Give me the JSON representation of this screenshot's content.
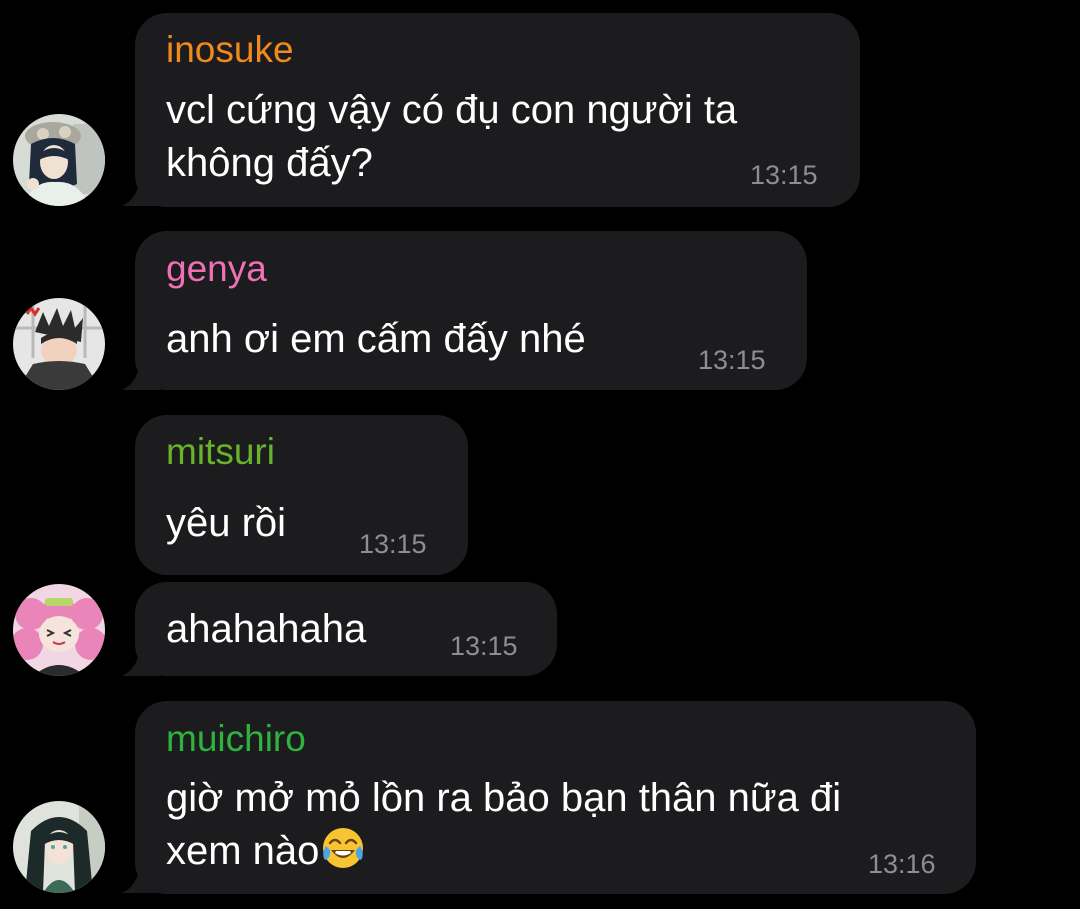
{
  "messages": [
    {
      "sender": "inosuke",
      "sender_color": "#ef8a1c",
      "lines": [
        "vcl cứng vậy có đụ con người ta",
        "không đấy?"
      ],
      "time": "13:15"
    },
    {
      "sender": "genya",
      "sender_color": "#ee70b5",
      "lines": [
        "anh ơi em cấm đấy nhé"
      ],
      "time": "13:15"
    },
    {
      "sender": "mitsuri",
      "sender_color": "#69b32c",
      "lines": [
        "yêu rồi"
      ],
      "time": "13:15"
    },
    {
      "sender": "",
      "lines": [
        "ahahahaha"
      ],
      "time": "13:15"
    },
    {
      "sender": "muichiro",
      "sender_color": "#2fb33f",
      "lines": [
        "giờ mở mỏ lồn ra bảo bạn thân nữa đi",
        "xem nào"
      ],
      "emoji": "face-with-tears-of-joy-emoji",
      "time": "13:16"
    }
  ],
  "colors": {
    "background": "#000000",
    "bubble": "#1c1c1e",
    "message_text": "#ffffff",
    "timestamp": "#8d8d93"
  }
}
